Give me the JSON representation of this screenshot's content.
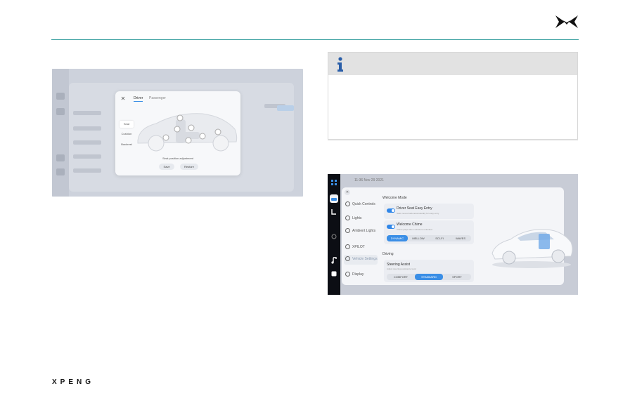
{
  "brand": {
    "logo_icon": "xpeng-x-logo-icon",
    "wordmark": "XPENG",
    "accent_color": "#3aa0a0"
  },
  "left_screenshot": {
    "modal": {
      "tabs": [
        "Driver",
        "Passenger"
      ],
      "active_tab": "Driver",
      "options": [
        "Seat",
        "Cushion",
        "Backrest"
      ],
      "selected_option": "Seat",
      "caption": "Seat position adjustment",
      "buttons": [
        "Save",
        "Restore"
      ]
    }
  },
  "info_box": {
    "icon": "info-icon"
  },
  "right_screenshot": {
    "status_bar": {
      "time": "11:36 Nov 29 2021"
    },
    "nav": [
      {
        "label": "Quick Controls",
        "icon": "home-icon"
      },
      {
        "label": "Lights",
        "icon": "headlight-icon"
      },
      {
        "label": "Ambient Lights",
        "icon": "ambient-light-icon"
      },
      {
        "label": "XPILOT",
        "icon": "steering-icon"
      },
      {
        "label": "Vehicle Settings",
        "icon": "car-settings-icon"
      },
      {
        "label": "Display",
        "icon": "display-icon"
      }
    ],
    "selected_nav": "Vehicle Settings",
    "welcome_mode": {
      "heading": "Welcome Mode",
      "driver_seat": {
        "label": "Driver Seat Easy Entry",
        "sub": "Seat moves back automatically for easy entry"
      },
      "chime": {
        "label": "Welcome Chime",
        "sub": "Chime plays when vehicle is unlocked"
      },
      "chime_options": [
        "DYNAMIC",
        "MELLOW",
        "SCI-FI",
        "WAVES"
      ],
      "chime_selected": "DYNAMIC"
    },
    "driving": {
      "heading": "Driving",
      "steering": {
        "label": "Steering Assist",
        "sub": "Adjust steering assistance level"
      },
      "steering_options": [
        "COMFORT",
        "STANDARD",
        "SPORT"
      ],
      "steering_selected": "STANDARD"
    }
  }
}
